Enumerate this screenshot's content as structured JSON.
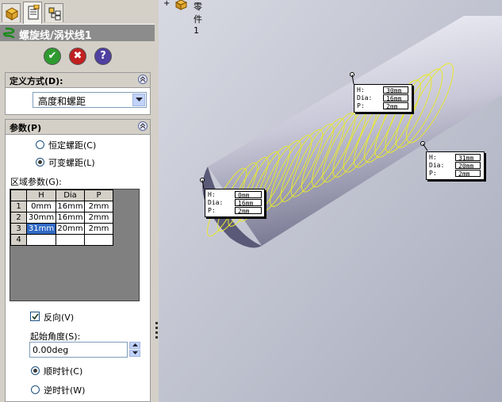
{
  "property_manager": {
    "tabs": [
      "feature-manager-tab",
      "property-manager-tab",
      "configuration-manager-tab"
    ],
    "title": "螺旋线/涡状线1",
    "buttons": {
      "ok": "✔",
      "cancel": "✖",
      "help": "?"
    },
    "definition": {
      "header": "定义方式(D):",
      "selected": "高度和螺距"
    },
    "parameters": {
      "header": "参数(P)",
      "constant_pitch": "恒定螺距(C)",
      "variable_pitch": "可变螺距(L)",
      "region_label": "区域参数(G):",
      "columns": [
        "H",
        "Dia",
        "P"
      ],
      "rows": [
        {
          "n": "1",
          "h": "0mm",
          "dia": "16mm",
          "p": "2mm"
        },
        {
          "n": "2",
          "h": "30mm",
          "dia": "16mm",
          "p": "2mm"
        },
        {
          "n": "3",
          "h": "31mm",
          "dia": "20mm",
          "p": "2mm"
        },
        {
          "n": "4",
          "h": "",
          "dia": "",
          "p": ""
        }
      ],
      "reverse": "反向(V)",
      "start_angle_label": "起始角度(S):",
      "start_angle_value": "0.00deg",
      "clockwise": "顺时针(C)",
      "counterclockwise": "逆时针(W)"
    }
  },
  "viewport": {
    "tree_root": "零件1",
    "expander": "+",
    "callouts": [
      {
        "h": "30mm",
        "dia": "16mm",
        "p": "2mm"
      },
      {
        "h": "31mm",
        "dia": "20mm",
        "p": "2mm"
      },
      {
        "h": "0mm",
        "dia": "16mm",
        "p": "2mm"
      }
    ],
    "labels": {
      "h": "H:",
      "dia": "Dia:",
      "p": "P:"
    }
  },
  "colors": {
    "ok": "#2f9a2f",
    "cancel": "#c02020",
    "help": "#5040a0",
    "helix": "#e8e830",
    "title_bar": "#8c8c8c"
  }
}
